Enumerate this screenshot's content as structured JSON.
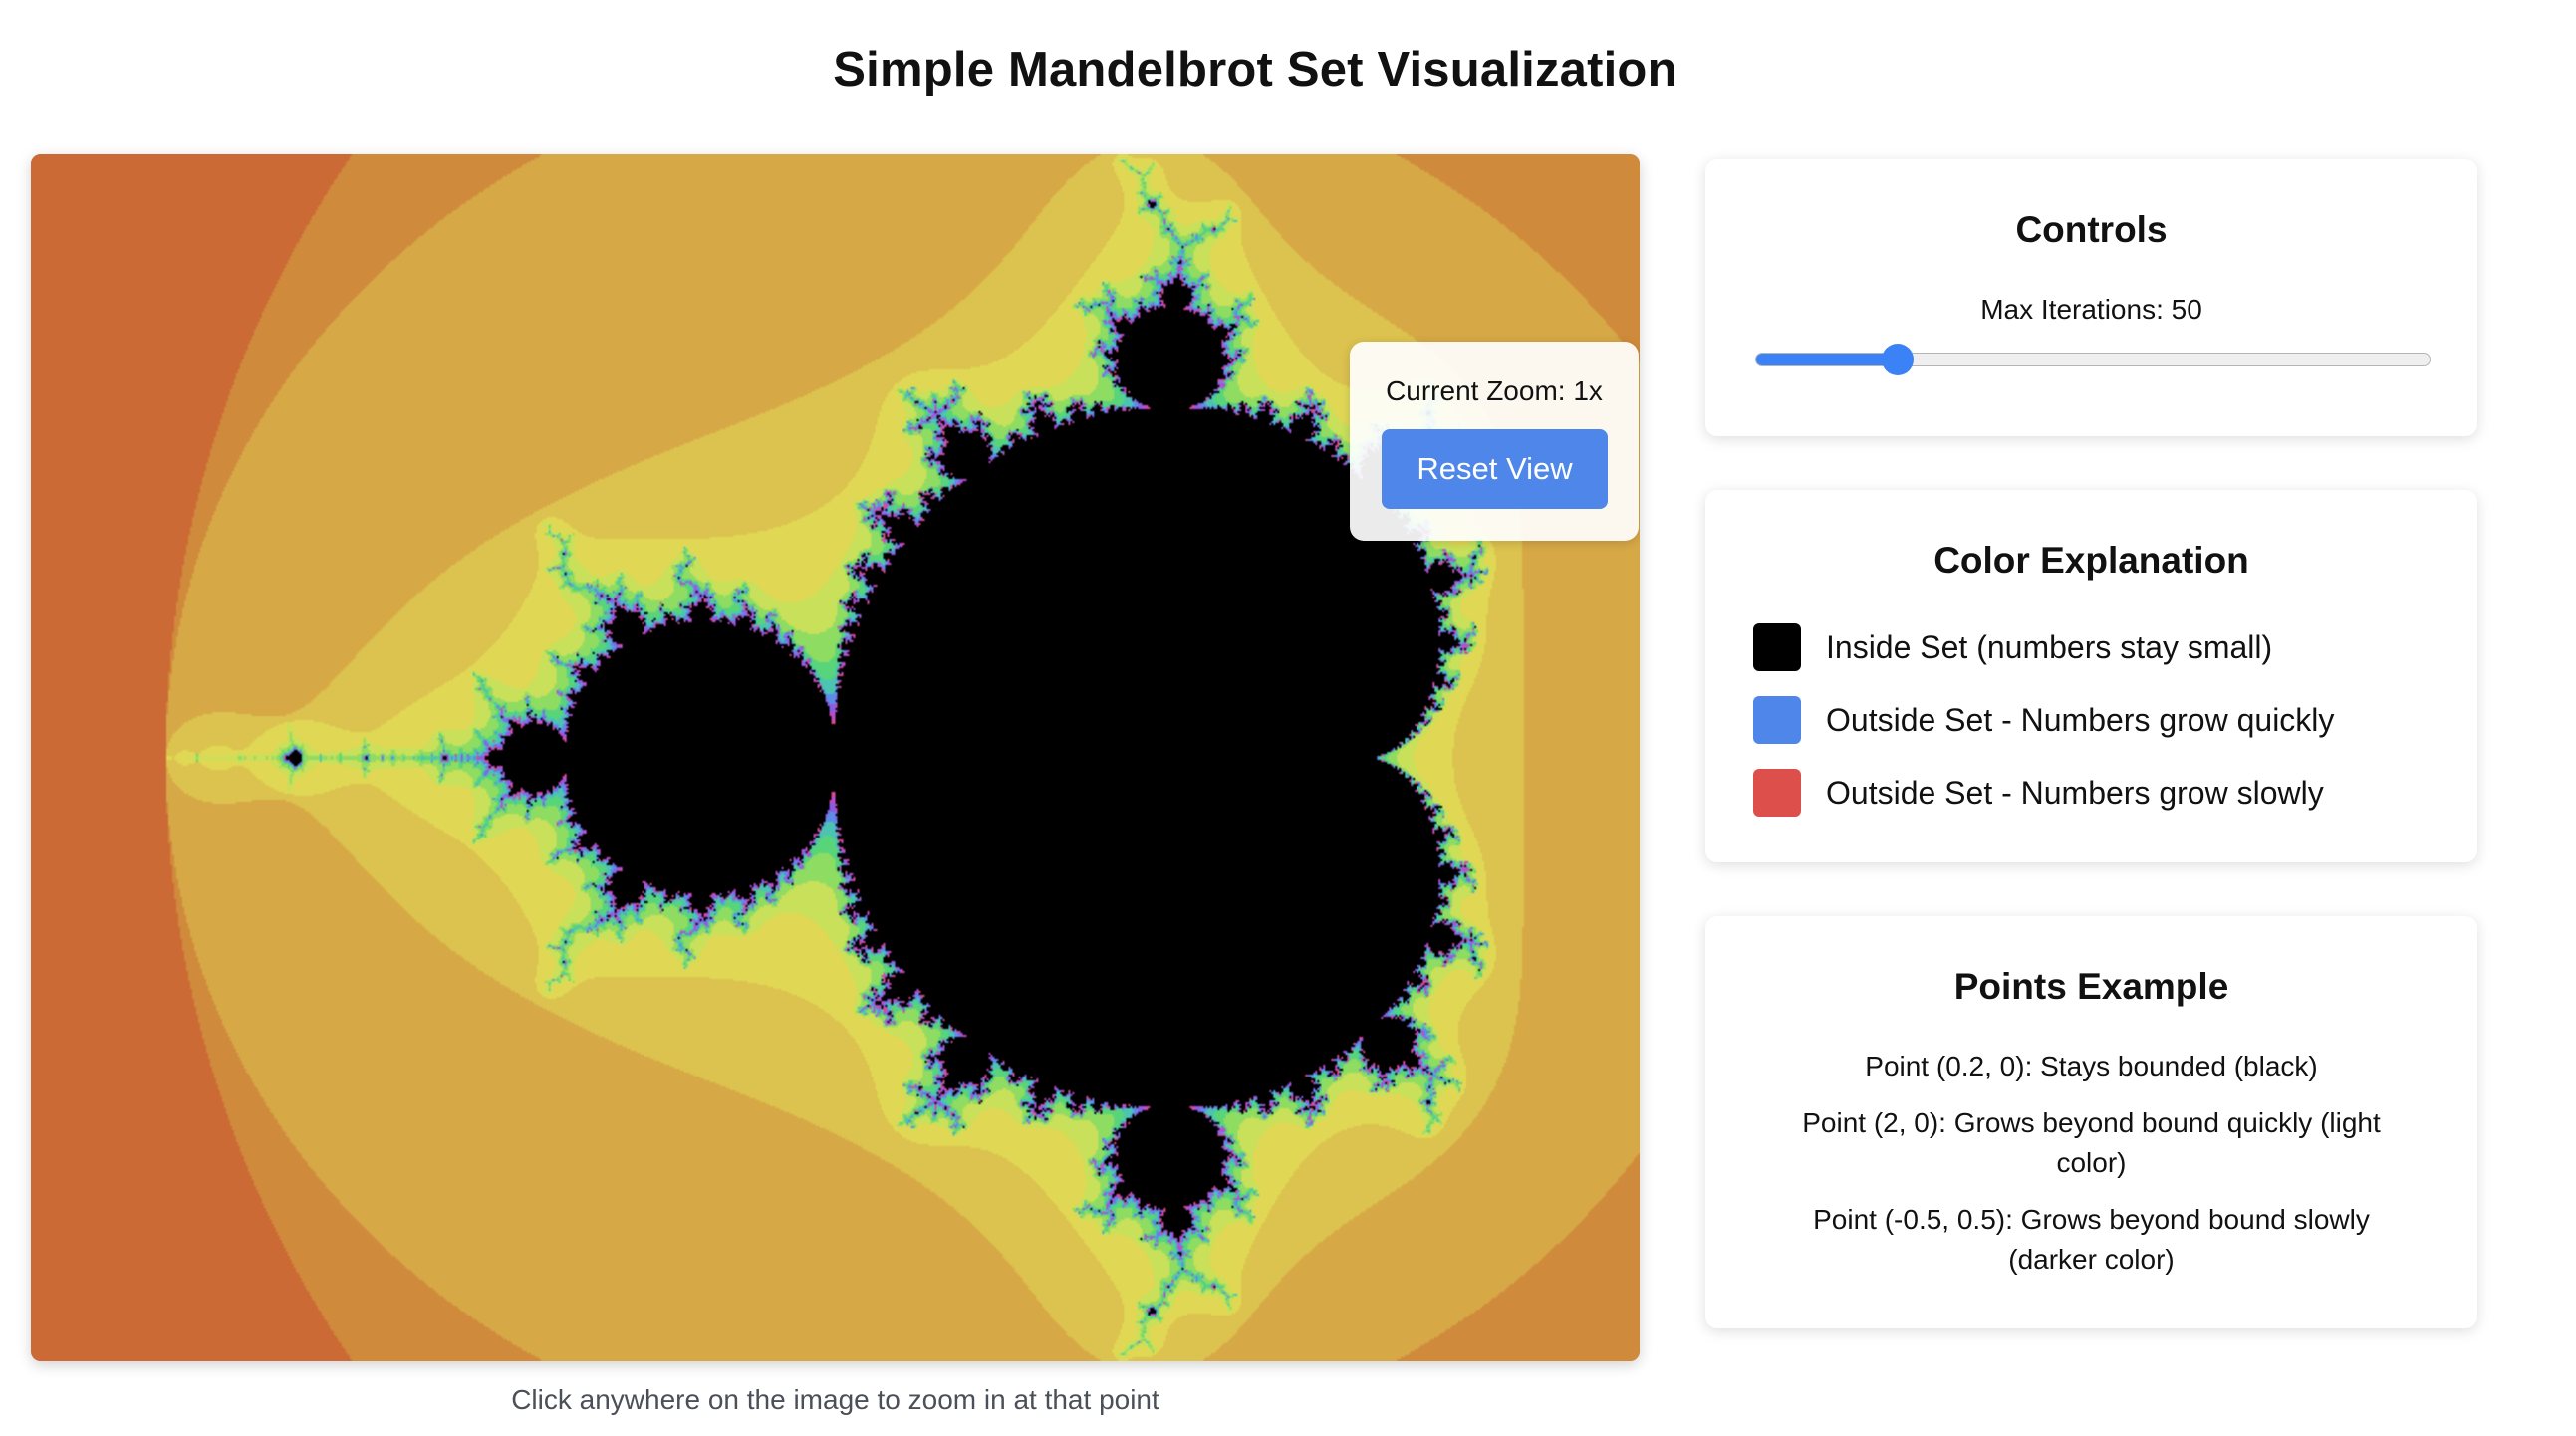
{
  "page": {
    "title": "Simple Mandelbrot Set Visualization",
    "hint": "Click anywhere on the image to zoom in at that point"
  },
  "zoom": {
    "text": "Current Zoom: 1x",
    "reset_label": "Reset View"
  },
  "controls": {
    "title": "Controls",
    "slider_label": "Max Iterations: 50",
    "slider_value": 50,
    "slider_min": 10,
    "slider_max": 200
  },
  "colors": {
    "title": "Color Explanation",
    "items": [
      {
        "label": "Inside Set (numbers stay small)",
        "color": "#000000"
      },
      {
        "label": "Outside Set - Numbers grow quickly",
        "color": "#4f86ea"
      },
      {
        "label": "Outside Set - Numbers grow slowly",
        "color": "#dd4f4a"
      }
    ]
  },
  "points": {
    "title": "Points Example",
    "lines": [
      "Point (0.2, 0): Stays bounded (black)",
      "Point (2, 0): Grows beyond bound quickly (light color)",
      "Point (-0.5, 0.5): Grows beyond bound slowly (darker color)"
    ]
  },
  "fractal": {
    "center_re": -0.75,
    "center_im": 0.0,
    "zoom": 1,
    "max_iterations": 50,
    "inside_color": "#000000",
    "palette": [
      "#c7512f",
      "#cc6a35",
      "#d08a3c",
      "#d6a846",
      "#dcc24e",
      "#e0d854",
      "#c8e05a",
      "#8fdc62",
      "#58d47a",
      "#4cc4b4",
      "#5c8ee8",
      "#8a5ee4",
      "#c04ad0",
      "#e04a8a"
    ]
  }
}
